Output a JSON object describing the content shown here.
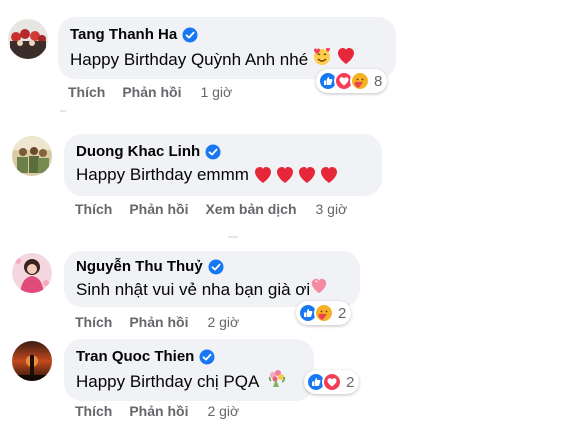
{
  "comments": [
    {
      "author": "Tang Thanh Ha",
      "text": "Happy Birthday Quỳnh Anh nhé",
      "actions": {
        "like": "Thích",
        "reply": "Phản hồi",
        "time": "1 giờ"
      },
      "reaction_count": "8",
      "reactions": [
        "like-icon",
        "love-icon",
        "care-icon"
      ]
    },
    {
      "author": "Duong Khac Linh",
      "text": "Happy Birthday emmm",
      "actions": {
        "like": "Thích",
        "reply": "Phản hồi",
        "translate": "Xem bản dịch",
        "time": "3 giờ"
      }
    },
    {
      "author": "Nguyễn Thu Thuỷ",
      "text": "Sinh nhật vui vẻ nha bạn già ơi",
      "actions": {
        "like": "Thích",
        "reply": "Phản hồi",
        "time": "2 giờ"
      },
      "reaction_count": "2",
      "reactions": [
        "like-icon",
        "care-icon"
      ]
    },
    {
      "author": "Tran Quoc Thien",
      "text": "Happy Birthday chị PQA",
      "actions": {
        "like": "Thích",
        "reply": "Phản hồi",
        "time": "2 giờ"
      },
      "reaction_count": "2",
      "reactions": [
        "like-icon",
        "love-icon"
      ]
    }
  ],
  "colors": {
    "bubble": "#f0f2f5",
    "action_text": "#65676b",
    "verified": "#1877f2",
    "heart": "#f33e58"
  }
}
